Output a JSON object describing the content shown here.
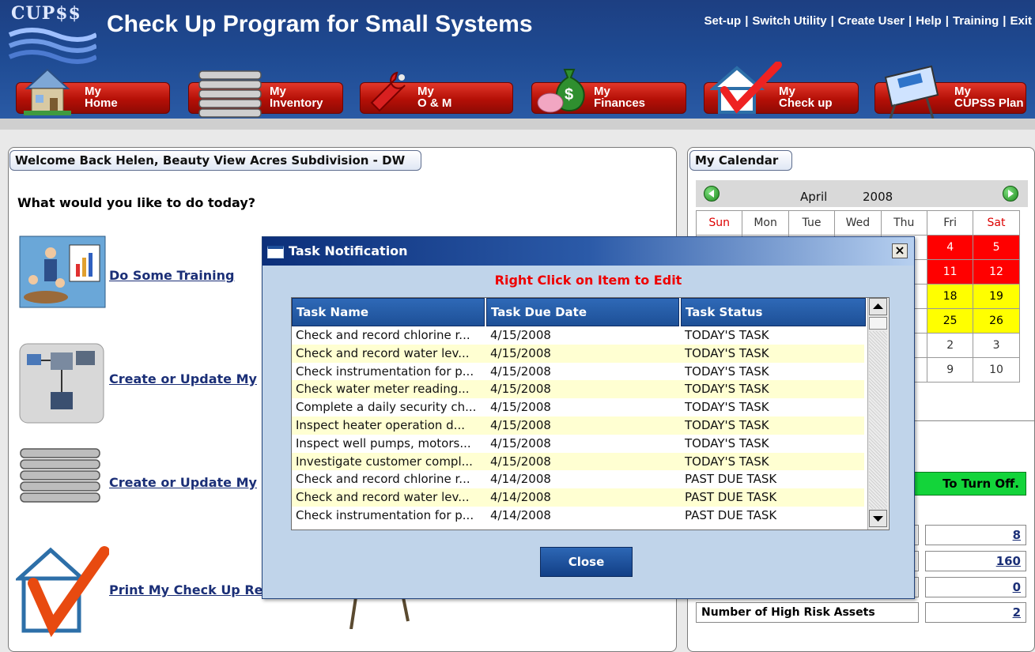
{
  "app": {
    "logo_text": "CUP$$",
    "title": "Check Up Program for Small Systems",
    "top_links": [
      "Set-up",
      "Switch Utility",
      "Create User",
      "Help",
      "Training",
      "Exit"
    ]
  },
  "nav": [
    {
      "line1": "My",
      "line2": "Home",
      "icon": "house-icon"
    },
    {
      "line1": "My",
      "line2": "Inventory",
      "icon": "pipes-icon"
    },
    {
      "line1": "My",
      "line2": "O & M",
      "icon": "wrench-icon"
    },
    {
      "line1": "My",
      "line2": "Finances",
      "icon": "money-bag-icon"
    },
    {
      "line1": "My",
      "line2": "Check up",
      "icon": "checkmark-house-icon"
    },
    {
      "line1": "My",
      "line2": "CUPSS Plan",
      "icon": "easel-icon"
    }
  ],
  "welcome": {
    "tab": "Welcome Back Helen, Beauty View Acres Subdivision - DW",
    "question": "What would you like to do today?",
    "actions": [
      {
        "label": "Do Some Training",
        "icon": "training-icon"
      },
      {
        "label": "Create or Update My",
        "icon": "system-diagram-icon"
      },
      {
        "label": "Create or Update My",
        "icon": "pipes-icon"
      },
      {
        "label": "Print My Check Up Re",
        "icon": "checkmark-house-icon"
      }
    ]
  },
  "calendar": {
    "tab": "My Calendar",
    "month": "April",
    "year": "2008",
    "weekdays": [
      "Sun",
      "Mon",
      "Tue",
      "Wed",
      "Thu",
      "Fri",
      "Sat"
    ],
    "visible_days": [
      {
        "day": "4",
        "status": "red"
      },
      {
        "day": "5",
        "status": "red"
      },
      {
        "day": "11",
        "status": "red"
      },
      {
        "day": "12",
        "status": "red"
      },
      {
        "day": "18",
        "status": "yellow"
      },
      {
        "day": "19",
        "status": "yellow"
      },
      {
        "day": "25",
        "status": "yellow"
      },
      {
        "day": "26",
        "status": "yellow"
      },
      {
        "day": "2",
        "status": "none"
      },
      {
        "day": "3",
        "status": "none"
      },
      {
        "day": "9",
        "status": "none"
      },
      {
        "day": "10",
        "status": "none"
      }
    ],
    "status_colors": {
      "red": "#ff0000",
      "yellow": "#ffff00"
    }
  },
  "alerts": {
    "turn_off_text": "To Turn Off."
  },
  "stats": [
    {
      "label": "",
      "value": "8"
    },
    {
      "label": "",
      "value": "160"
    },
    {
      "label": "",
      "value": "0"
    },
    {
      "label": "Number of High Risk Assets",
      "value": "2"
    }
  ],
  "dialog": {
    "title": "Task Notification",
    "close_x": "×",
    "hint": "Right Click on Item to Edit",
    "columns": [
      "Task Name",
      "Task Due Date",
      "Task Status"
    ],
    "rows": [
      [
        "Check and record chlorine r...",
        "4/15/2008",
        "TODAY'S TASK"
      ],
      [
        "Check and record water lev...",
        "4/15/2008",
        "TODAY'S TASK"
      ],
      [
        "Check instrumentation for p...",
        "4/15/2008",
        "TODAY'S TASK"
      ],
      [
        "Check water meter reading...",
        "4/15/2008",
        "TODAY'S TASK"
      ],
      [
        "Complete a daily security ch...",
        "4/15/2008",
        "TODAY'S TASK"
      ],
      [
        "Inspect heater operation d...",
        "4/15/2008",
        "TODAY'S TASK"
      ],
      [
        "Inspect well pumps, motors...",
        "4/15/2008",
        "TODAY'S TASK"
      ],
      [
        "Investigate customer compl...",
        "4/15/2008",
        "TODAY'S TASK"
      ],
      [
        "Check and record chlorine r...",
        "4/14/2008",
        "PAST DUE TASK"
      ],
      [
        "Check and record water lev...",
        "4/14/2008",
        "PAST DUE TASK"
      ],
      [
        "Check instrumentation for p...",
        "4/14/2008",
        "PAST DUE TASK"
      ]
    ],
    "close_button": "Close"
  },
  "colors": {
    "header_blue": "#1e4a92",
    "nav_red": "#b40f06",
    "link_blue": "#1b2f77",
    "hint_red": "#e00000",
    "row_alt": "#ffffd2",
    "alert_green": "#13d43a"
  }
}
